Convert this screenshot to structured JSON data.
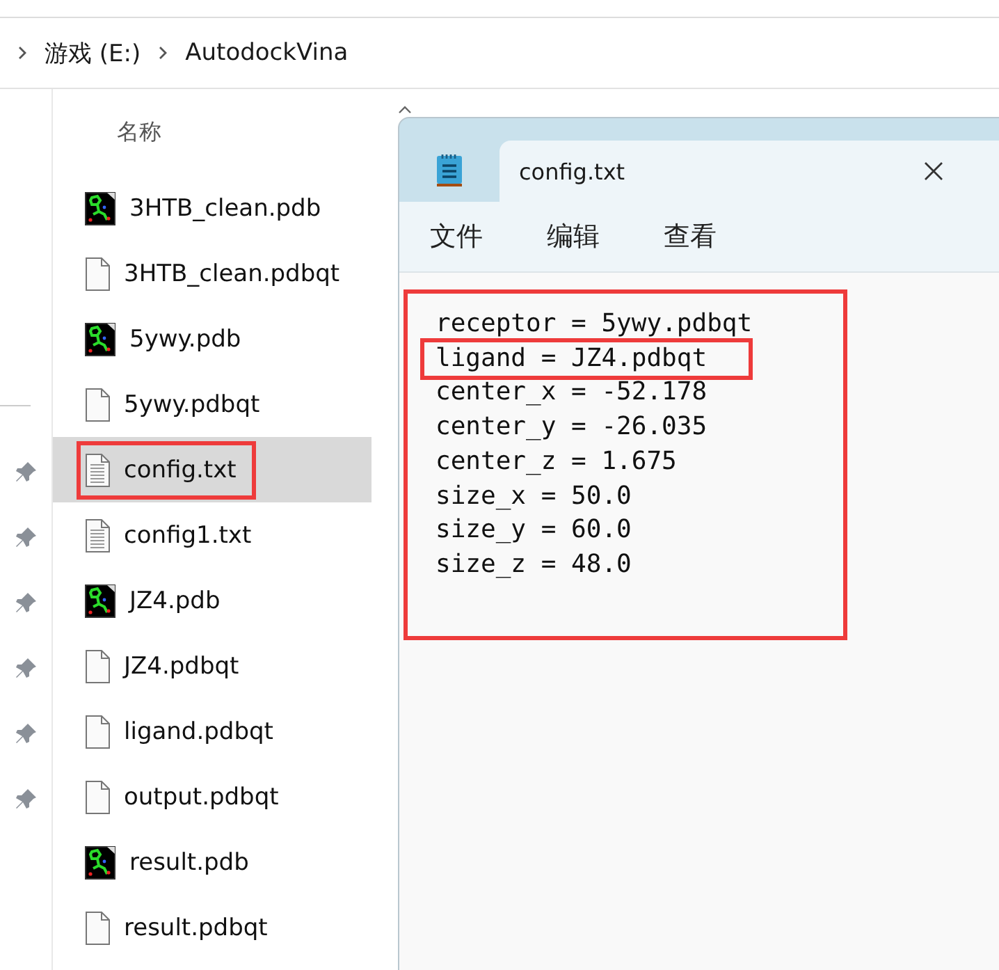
{
  "breadcrumb": [
    "游戏 (E:)",
    "AutodockVina"
  ],
  "file_list": {
    "column": "名称",
    "files": [
      {
        "name": "3HTB_clean.pdb",
        "kind": "pdb",
        "selected": false,
        "highlighted": false
      },
      {
        "name": "3HTB_clean.pdbqt",
        "kind": "file",
        "selected": false,
        "highlighted": false
      },
      {
        "name": "5ywy.pdb",
        "kind": "pdb",
        "selected": false,
        "highlighted": false
      },
      {
        "name": "5ywy.pdbqt",
        "kind": "file",
        "selected": false,
        "highlighted": false
      },
      {
        "name": "config.txt",
        "kind": "text",
        "selected": true,
        "highlighted": true
      },
      {
        "name": "config1.txt",
        "kind": "text",
        "selected": false,
        "highlighted": false
      },
      {
        "name": "JZ4.pdb",
        "kind": "pdb",
        "selected": false,
        "highlighted": false
      },
      {
        "name": "JZ4.pdbqt",
        "kind": "file",
        "selected": false,
        "highlighted": false
      },
      {
        "name": "ligand.pdbqt",
        "kind": "file",
        "selected": false,
        "highlighted": false
      },
      {
        "name": "output.pdbqt",
        "kind": "file",
        "selected": false,
        "highlighted": false
      },
      {
        "name": "result.pdb",
        "kind": "pdb",
        "selected": false,
        "highlighted": false
      },
      {
        "name": "result.pdbqt",
        "kind": "file",
        "selected": false,
        "highlighted": false
      }
    ]
  },
  "notepad": {
    "tab": "config.txt",
    "menu": [
      "文件",
      "编辑",
      "查看"
    ],
    "highlighted": true,
    "lines": [
      {
        "text": "receptor = 5ywy.pdbqt",
        "highlighted": false
      },
      {
        "text": "ligand = JZ4.pdbqt",
        "highlighted": true
      },
      {
        "text": "center_x = -52.178",
        "highlighted": false
      },
      {
        "text": "center_y = -26.035",
        "highlighted": false
      },
      {
        "text": "center_z = 1.675",
        "highlighted": false
      },
      {
        "text": "size_x = 50.0",
        "highlighted": false
      },
      {
        "text": "size_y = 60.0",
        "highlighted": false
      },
      {
        "text": "size_z = 48.0",
        "highlighted": false
      }
    ]
  }
}
